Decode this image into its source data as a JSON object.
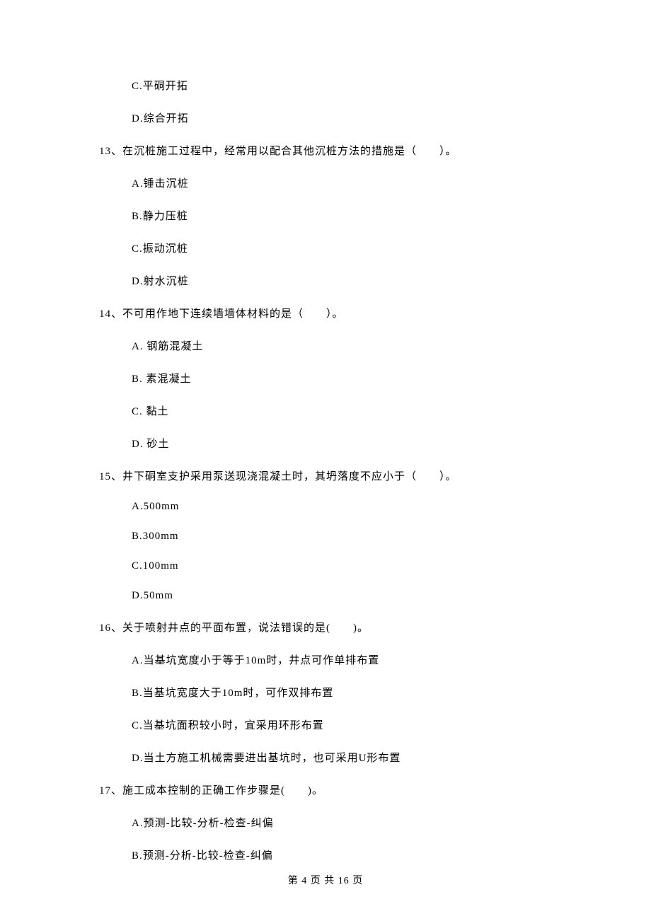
{
  "orphan_options": [
    "C.平硐开拓",
    "D.综合开拓"
  ],
  "questions": [
    {
      "stem": "13、在沉桩施工过程中，经常用以配合其他沉桩方法的措施是（　　）。",
      "options": [
        "A.锤击沉桩",
        "B.静力压桩",
        "C.振动沉桩",
        "D.射水沉桩"
      ]
    },
    {
      "stem": "14、不可用作地下连续墙墙体材料的是（　　）。",
      "options": [
        "A.  钢筋混凝土",
        "B.  素混凝土",
        "C.  黏土",
        "D.  砂土"
      ]
    },
    {
      "stem": "15、井下硐室支护采用泵送现浇混凝土时，其坍落度不应小于（　　）。",
      "options": [
        "A.500mm",
        "B.300mm",
        "C.100mm",
        "D.50mm"
      ]
    },
    {
      "stem": "16、关于喷射井点的平面布置，说法错误的是(　　)。",
      "options": [
        "A.当基坑宽度小于等于10m时，井点可作单排布置",
        "B.当基坑宽度大于10m时，可作双排布置",
        "C.当基坑面积较小时，宜采用环形布置",
        "D.当土方施工机械需要进出基坑时，也可采用U形布置"
      ]
    },
    {
      "stem": "17、施工成本控制的正确工作步骤是(　　)。",
      "options": [
        "A.预测-比较-分析-检查-纠偏",
        "B.预测-分析-比较-检查-纠偏"
      ]
    }
  ],
  "footer": "第 4 页 共 16 页"
}
